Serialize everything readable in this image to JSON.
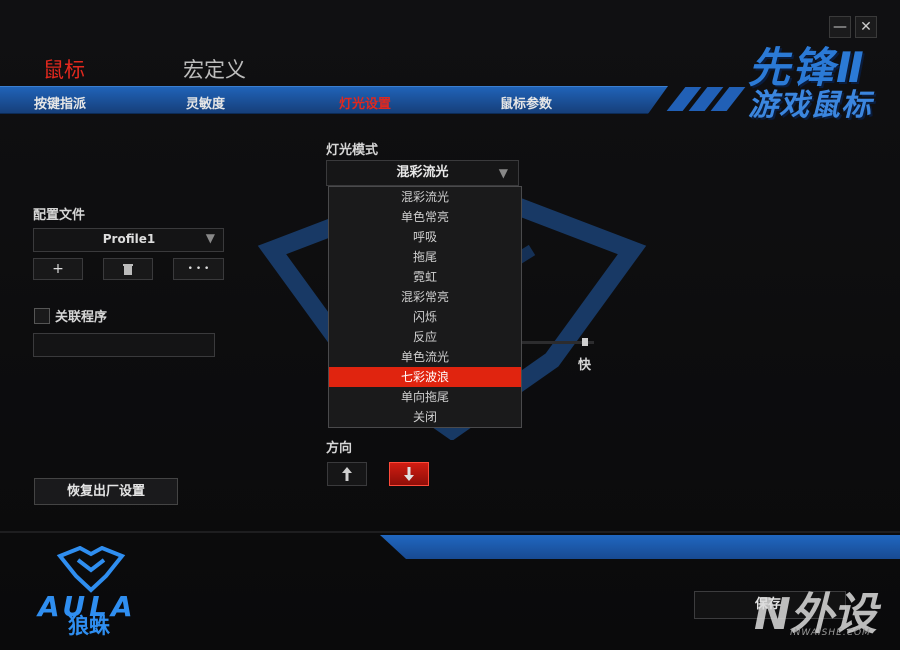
{
  "window": {
    "minimize_glyph": "—",
    "close_glyph": "✕"
  },
  "brand": {
    "title": "先锋Ⅱ",
    "subtitle": "游戏鼠标",
    "logo_text": "AULA",
    "logo_cn": "狼蛛"
  },
  "top_tabs": {
    "mouse": "鼠标",
    "macro": "宏定义"
  },
  "nav": {
    "items": [
      "按键指派",
      "灵敏度",
      "灯光设置",
      "鼠标参数"
    ],
    "active_color": "#e0281e"
  },
  "profile": {
    "label": "配置文件",
    "selected": "Profile1",
    "add_glyph": "+",
    "more_glyph": "• • •"
  },
  "link_program": {
    "label": "关联程序",
    "checked": false,
    "value": ""
  },
  "reset_button": "恢复出厂设置",
  "light": {
    "mode_label": "灯光模式",
    "mode_selected": "混彩流光",
    "options": [
      "混彩流光",
      "单色常亮",
      "呼吸",
      "拖尾",
      "霓虹",
      "混彩常亮",
      "闪烁",
      "反应",
      "单色流光",
      "七彩波浪",
      "单向拖尾",
      "关闭"
    ],
    "highlighted_index": 9,
    "speed_fast_label": "快",
    "direction_label": "方向"
  },
  "save_button": "保存",
  "watermark": {
    "text": "N外设",
    "sub": "INWAISHE.COM"
  },
  "colors": {
    "accent_red": "#e0240f",
    "brand_blue": "#1f56a8"
  }
}
